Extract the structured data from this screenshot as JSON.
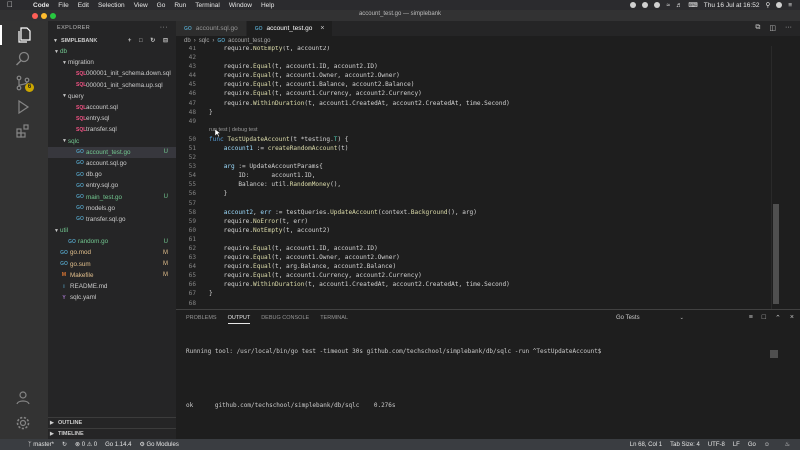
{
  "menubar": {
    "items": [
      "Code",
      "File",
      "Edit",
      "Selection",
      "View",
      "Go",
      "Run",
      "Terminal",
      "Window",
      "Help"
    ],
    "clock": "Thu 16 Jul at 16:52"
  },
  "window": {
    "title": "account_test.go — simplebank"
  },
  "sidebar": {
    "header": "EXPLORER",
    "project": "SIMPLEBANK",
    "tree": [
      {
        "label": "db",
        "depth": 0,
        "kind": "folder",
        "open": true,
        "status": "",
        "color": "U"
      },
      {
        "label": "migration",
        "depth": 1,
        "kind": "folder",
        "open": true,
        "status": "",
        "color": ""
      },
      {
        "label": "000001_init_schema.down.sql",
        "depth": 2,
        "kind": "sql",
        "status": "",
        "color": ""
      },
      {
        "label": "000001_init_schema.up.sql",
        "depth": 2,
        "kind": "sql",
        "status": "",
        "color": ""
      },
      {
        "label": "query",
        "depth": 1,
        "kind": "folder",
        "open": true,
        "status": "",
        "color": ""
      },
      {
        "label": "account.sql",
        "depth": 2,
        "kind": "sql",
        "status": "",
        "color": ""
      },
      {
        "label": "entry.sql",
        "depth": 2,
        "kind": "sql",
        "status": "",
        "color": ""
      },
      {
        "label": "transfer.sql",
        "depth": 2,
        "kind": "sql",
        "status": "",
        "color": ""
      },
      {
        "label": "sqlc",
        "depth": 1,
        "kind": "folder",
        "open": true,
        "status": "",
        "color": "U"
      },
      {
        "label": "account_test.go",
        "depth": 2,
        "kind": "go",
        "status": "U",
        "color": "U",
        "selected": true
      },
      {
        "label": "account.sql.go",
        "depth": 2,
        "kind": "go",
        "status": "",
        "color": ""
      },
      {
        "label": "db.go",
        "depth": 2,
        "kind": "go",
        "status": "",
        "color": ""
      },
      {
        "label": "entry.sql.go",
        "depth": 2,
        "kind": "go",
        "status": "",
        "color": ""
      },
      {
        "label": "main_test.go",
        "depth": 2,
        "kind": "go",
        "status": "U",
        "color": "U"
      },
      {
        "label": "models.go",
        "depth": 2,
        "kind": "go",
        "status": "",
        "color": ""
      },
      {
        "label": "transfer.sql.go",
        "depth": 2,
        "kind": "go",
        "status": "",
        "color": ""
      },
      {
        "label": "util",
        "depth": 0,
        "kind": "folder",
        "open": true,
        "status": "",
        "color": "U"
      },
      {
        "label": "random.go",
        "depth": 1,
        "kind": "go",
        "status": "U",
        "color": "U"
      },
      {
        "label": "go.mod",
        "depth": 0,
        "kind": "go",
        "status": "M",
        "color": "M"
      },
      {
        "label": "go.sum",
        "depth": 0,
        "kind": "go",
        "status": "M",
        "color": "M"
      },
      {
        "label": "Makefile",
        "depth": 0,
        "kind": "make",
        "status": "M",
        "color": "M"
      },
      {
        "label": "README.md",
        "depth": 0,
        "kind": "md",
        "status": "",
        "color": ""
      },
      {
        "label": "sqlc.yaml",
        "depth": 0,
        "kind": "yml",
        "status": "",
        "color": ""
      }
    ],
    "outline": "OUTLINE",
    "timeline": "TIMELINE"
  },
  "activity": {
    "scm_badge": "6"
  },
  "tabs": [
    {
      "label": "account.sql.go",
      "active": false
    },
    {
      "label": "account_test.go",
      "active": true
    }
  ],
  "breadcrumb": [
    "db",
    "sqlc",
    "account_test.go"
  ],
  "code_lines": [
    {
      "n": "41",
      "segs": [
        [
          "",
          "\trequire."
        ],
        [
          "fn",
          "NotEmpty"
        ],
        [
          "",
          "(t, account2)"
        ]
      ]
    },
    {
      "n": "42",
      "segs": []
    },
    {
      "n": "43",
      "segs": [
        [
          "",
          "\trequire."
        ],
        [
          "fn",
          "Equal"
        ],
        [
          "",
          "(t, account1.ID, account2.ID)"
        ]
      ]
    },
    {
      "n": "44",
      "segs": [
        [
          "",
          "\trequire."
        ],
        [
          "fn",
          "Equal"
        ],
        [
          "",
          "(t, account1.Owner, account2.Owner)"
        ]
      ]
    },
    {
      "n": "45",
      "segs": [
        [
          "",
          "\trequire."
        ],
        [
          "fn",
          "Equal"
        ],
        [
          "",
          "(t, account1.Balance, account2.Balance)"
        ]
      ]
    },
    {
      "n": "46",
      "segs": [
        [
          "",
          "\trequire."
        ],
        [
          "fn",
          "Equal"
        ],
        [
          "",
          "(t, account1.Currency, account2.Currency)"
        ]
      ]
    },
    {
      "n": "47",
      "segs": [
        [
          "",
          "\trequire."
        ],
        [
          "fn",
          "WithinDuration"
        ],
        [
          "",
          "(t, account1.CreatedAt, account2.CreatedAt, time.Second)"
        ]
      ]
    },
    {
      "n": "48",
      "segs": [
        [
          "",
          "}"
        ]
      ]
    },
    {
      "n": "49",
      "segs": []
    },
    {
      "lens": "run test | debug test"
    },
    {
      "n": "50",
      "segs": [
        [
          "kw",
          "func "
        ],
        [
          "fn",
          "TestUpdateAccount"
        ],
        [
          "",
          "(t "
        ],
        [
          "",
          "*testing."
        ],
        [
          "ty",
          "T"
        ],
        [
          "",
          ") {"
        ]
      ]
    },
    {
      "n": "51",
      "segs": [
        [
          "",
          "\t"
        ],
        [
          "va",
          "account1"
        ],
        [
          "",
          " := "
        ],
        [
          "fn",
          "createRandomAccount"
        ],
        [
          "",
          "(t)"
        ]
      ]
    },
    {
      "n": "52",
      "segs": []
    },
    {
      "n": "53",
      "segs": [
        [
          "",
          "\t"
        ],
        [
          "va",
          "arg"
        ],
        [
          "",
          " := UpdateAccountParams{"
        ]
      ]
    },
    {
      "n": "54",
      "segs": [
        [
          "",
          "\t\tID:      account1.ID,"
        ]
      ]
    },
    {
      "n": "55",
      "segs": [
        [
          "",
          "\t\tBalance: util."
        ],
        [
          "fn",
          "RandomMoney"
        ],
        [
          "",
          "(),"
        ]
      ]
    },
    {
      "n": "56",
      "segs": [
        [
          "",
          "\t}"
        ]
      ]
    },
    {
      "n": "57",
      "segs": []
    },
    {
      "n": "58",
      "segs": [
        [
          "",
          "\t"
        ],
        [
          "va",
          "account2"
        ],
        [
          "",
          ", "
        ],
        [
          "va",
          "err"
        ],
        [
          "",
          " := testQueries."
        ],
        [
          "fn",
          "UpdateAccount"
        ],
        [
          "",
          "(context."
        ],
        [
          "fn",
          "Background"
        ],
        [
          "",
          "(), arg)"
        ]
      ]
    },
    {
      "n": "59",
      "segs": [
        [
          "",
          "\trequire."
        ],
        [
          "fn",
          "NoError"
        ],
        [
          "",
          "(t, err)"
        ]
      ]
    },
    {
      "n": "60",
      "segs": [
        [
          "",
          "\trequire."
        ],
        [
          "fn",
          "NotEmpty"
        ],
        [
          "",
          "(t, account2)"
        ]
      ]
    },
    {
      "n": "61",
      "segs": []
    },
    {
      "n": "62",
      "segs": [
        [
          "",
          "\trequire."
        ],
        [
          "fn",
          "Equal"
        ],
        [
          "",
          "(t, account1.ID, account2.ID)"
        ]
      ]
    },
    {
      "n": "63",
      "segs": [
        [
          "",
          "\trequire."
        ],
        [
          "fn",
          "Equal"
        ],
        [
          "",
          "(t, account1.Owner, account2.Owner)"
        ]
      ]
    },
    {
      "n": "64",
      "segs": [
        [
          "",
          "\trequire."
        ],
        [
          "fn",
          "Equal"
        ],
        [
          "",
          "(t, arg.Balance, account2.Balance)"
        ]
      ]
    },
    {
      "n": "65",
      "segs": [
        [
          "",
          "\trequire."
        ],
        [
          "fn",
          "Equal"
        ],
        [
          "",
          "(t, account1.Currency, account2.Currency)"
        ]
      ]
    },
    {
      "n": "66",
      "segs": [
        [
          "",
          "\trequire."
        ],
        [
          "fn",
          "WithinDuration"
        ],
        [
          "",
          "(t, account1.CreatedAt, account2.CreatedAt, time.Second)"
        ]
      ]
    },
    {
      "n": "67",
      "segs": [
        [
          "",
          "}"
        ]
      ]
    },
    {
      "n": "68",
      "segs": []
    }
  ],
  "panel": {
    "tabs": [
      "PROBLEMS",
      "OUTPUT",
      "DEBUG CONSOLE",
      "TERMINAL"
    ],
    "active_tab": "OUTPUT",
    "channel": "Go Tests",
    "output_lines": [
      "Running tool: /usr/local/bin/go test -timeout 30s github.com/techschool/simplebank/db/sqlc -run ^TestUpdateAccount$",
      "",
      "ok  \tgithub.com/techschool/simplebank/db/sqlc\t0.276s"
    ]
  },
  "statusbar": {
    "branch": "master*",
    "errors": "0",
    "warnings": "0",
    "go_version": "Go 1.14.4",
    "go_modules": "Go Modules",
    "position": "Ln 68, Col 1",
    "tab_size": "Tab Size: 4",
    "encoding": "UTF-8",
    "eol": "LF",
    "language": "Go"
  },
  "colors": {
    "accent": "#007acc",
    "untracked": "#73c991",
    "modified": "#e2c08d",
    "function": "#dcdcaa",
    "keyword": "#569cd6"
  }
}
